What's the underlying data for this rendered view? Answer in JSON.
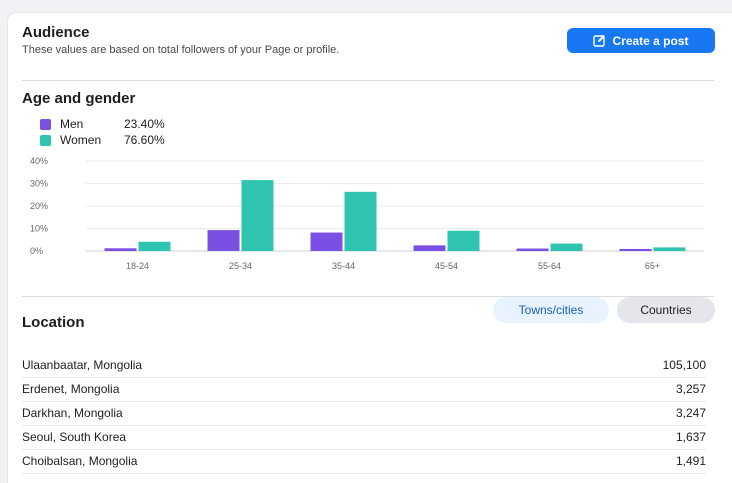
{
  "header": {
    "title": "Audience",
    "subtitle": "These values are based on total followers of your Page or profile.",
    "create_post_label": "Create a post"
  },
  "age_gender": {
    "title": "Age and gender",
    "legend": [
      {
        "name": "Men",
        "value": "23.40%",
        "color": "#7a4fe3"
      },
      {
        "name": "Women",
        "value": "76.60%",
        "color": "#2ec4b0"
      }
    ]
  },
  "chart_data": {
    "type": "bar",
    "categories": [
      "18-24",
      "25-34",
      "35-44",
      "45-54",
      "55-64",
      "65+"
    ],
    "series": [
      {
        "name": "Men",
        "values": [
          1.2,
          9.3,
          8.2,
          2.5,
          1.1,
          0.9
        ]
      },
      {
        "name": "Women",
        "values": [
          4.1,
          31.5,
          26.3,
          9.0,
          3.3,
          1.6
        ]
      }
    ],
    "yticks": [
      "0%",
      "10%",
      "20%",
      "30%",
      "40%"
    ],
    "ylim": [
      0,
      40
    ],
    "grid": true,
    "legend": "top-left"
  },
  "location": {
    "title": "Location",
    "toggle_towns": "Towns/cities",
    "toggle_countries": "Countries",
    "rows": [
      {
        "name": "Ulaanbaatar, Mongolia",
        "value": "105,100"
      },
      {
        "name": "Erdenet, Mongolia",
        "value": "3,257"
      },
      {
        "name": "Darkhan, Mongolia",
        "value": "3,247"
      },
      {
        "name": "Seoul, South Korea",
        "value": "1,637"
      },
      {
        "name": "Choibalsan, Mongolia",
        "value": "1,491"
      }
    ]
  }
}
